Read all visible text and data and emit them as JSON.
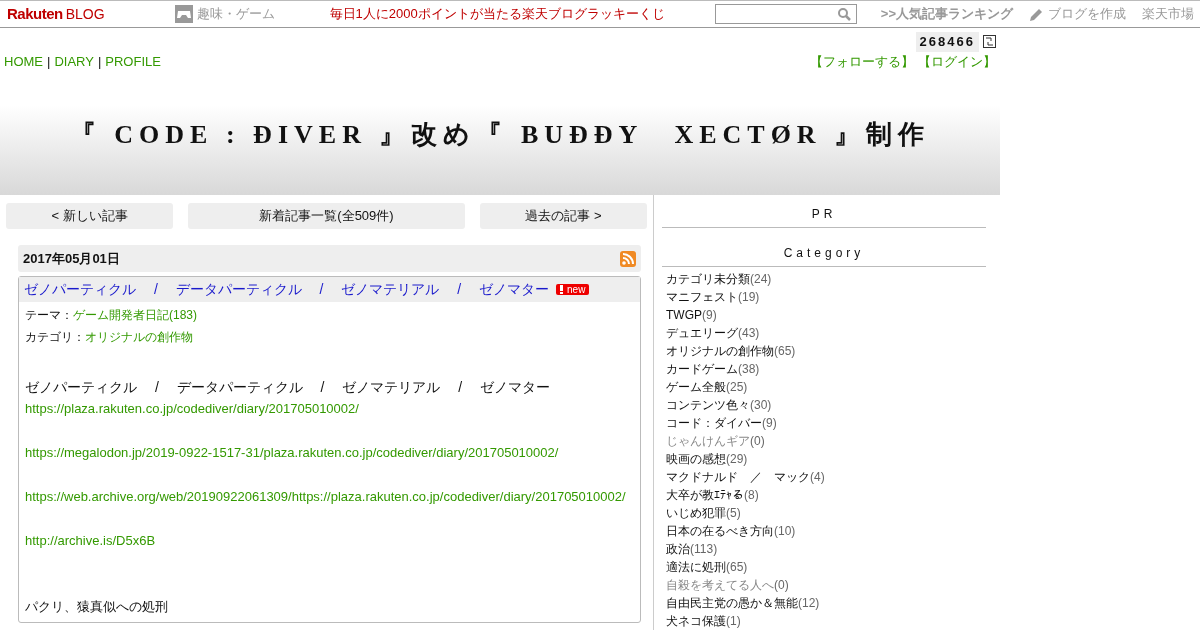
{
  "topbar": {
    "logo_main": "Rakuten",
    "logo_sub": "BLOG",
    "genre": "趣味・ゲーム",
    "promo": "毎日1人に2000ポイントが当たる楽天ブログラッキーくじ",
    "ranking": ">>人気記事ランキング",
    "create": "ブログを作成",
    "market": "楽天市場"
  },
  "counter": "268466",
  "nav": [
    "HOME",
    "DIARY",
    "PROFILE"
  ],
  "nav_separator": "|",
  "account_links": [
    "【フォローする】",
    "【ログイン】"
  ],
  "blog_title": "『 CODE : ĐIVER 』改め『 BUĐĐY　XECTØR 』制作",
  "pager": [
    "< 新しい記事",
    "新着記事一覧(全509件)",
    "過去の記事 >"
  ],
  "date": "2017年05月01日",
  "post": {
    "title": "ゼノパーティクル　 /　 データパーティクル　 /　 ゼノマテリアル　 /　 ゼノマター",
    "new": true,
    "new_label": "new",
    "theme_label": "テーマ：",
    "theme": "ゲーム開発者日記(183)",
    "category_label": "カテゴリ：",
    "category": "オリジナルの創作物",
    "body": [
      {
        "kind": "text",
        "text": "ゼノパーティクル　 /　 データパーティクル　 /　 ゼノマテリアル　 /　 ゼノマター"
      },
      {
        "kind": "link",
        "text": "https://plaza.rakuten.co.jp/codediver/diary/201705010002/"
      },
      {
        "kind": "link",
        "text": "https://megalodon.jp/2019-0922-1517-31/plaza.rakuten.co.jp/codediver/diary/201705010002/"
      },
      {
        "kind": "link",
        "text": "https://web.archive.org/web/20190922061309/https://plaza.rakuten.co.jp/codediver/diary/201705010002/"
      },
      {
        "kind": "link",
        "text": "http://archive.is/D5x6B"
      },
      {
        "kind": "text",
        "text": "パクリ、猿真似への処刑"
      }
    ]
  },
  "sidebar": {
    "pr": "PR",
    "category_heading": "Category",
    "categories": [
      {
        "name": "カテゴリ未分類",
        "count": "(24)",
        "disabled": false
      },
      {
        "name": "マニフェスト",
        "count": "(19)",
        "disabled": false
      },
      {
        "name": "TWGP",
        "count": "(9)",
        "disabled": false
      },
      {
        "name": "デュエリーグ",
        "count": "(43)",
        "disabled": false
      },
      {
        "name": "オリジナルの創作物",
        "count": "(65)",
        "disabled": false
      },
      {
        "name": "カードゲーム",
        "count": "(38)",
        "disabled": false
      },
      {
        "name": "ゲーム全般",
        "count": "(25)",
        "disabled": false
      },
      {
        "name": "コンテンツ色々",
        "count": "(30)",
        "disabled": false
      },
      {
        "name": "コード：ダイバー",
        "count": "(9)",
        "disabled": false
      },
      {
        "name": "じゃんけんギア",
        "count": "(0)",
        "disabled": true
      },
      {
        "name": "映画の感想",
        "count": "(29)",
        "disabled": false
      },
      {
        "name": "マクドナルド　／　マック",
        "count": "(4)",
        "disabled": false
      },
      {
        "name": "大卒が教ｴﾃｬる",
        "count": "(8)",
        "disabled": false
      },
      {
        "name": "いじめ犯罪",
        "count": "(5)",
        "disabled": false
      },
      {
        "name": "日本の在るべき方向",
        "count": "(10)",
        "disabled": false
      },
      {
        "name": "政治",
        "count": "(113)",
        "disabled": false
      },
      {
        "name": "適法に処刑",
        "count": "(65)",
        "disabled": false
      },
      {
        "name": "自殺を考えてる人へ",
        "count": "(0)",
        "disabled": true
      },
      {
        "name": "自由民主党の愚か＆無能",
        "count": "(12)",
        "disabled": false
      },
      {
        "name": "犬ネコ保護",
        "count": "(1)",
        "disabled": false
      }
    ]
  }
}
